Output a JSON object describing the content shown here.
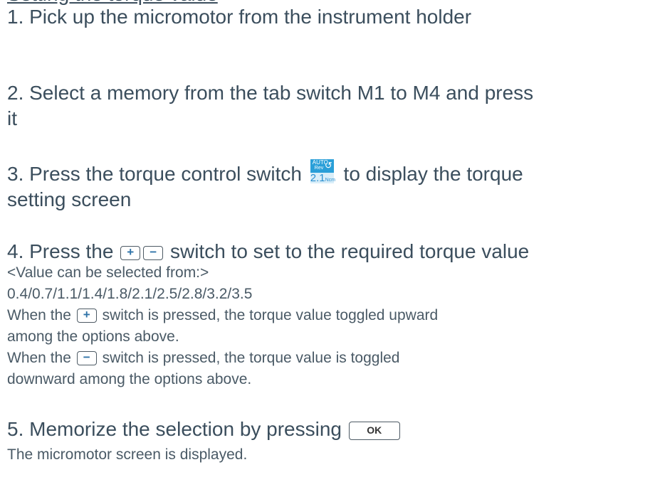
{
  "heading_fragment": "Setting the torque value",
  "steps": [
    {
      "text": "1. Pick up the micromotor from the instrument holder"
    },
    {
      "line1": "2. Select a memory from the tab switch M1 to M4 and press",
      "line2": "it"
    },
    {
      "before": "3. Press the torque control switch",
      "after": "to display the torque",
      "line2": "setting screen"
    },
    {
      "before": "4. Press the",
      "after": "switch to set to the required torque value"
    },
    {
      "before": "5. Memorize the selection by pressing"
    }
  ],
  "notes": {
    "range_label": "<Value can be selected from:>",
    "range_values": "0.4/0.7/1.1/1.4/1.8/2.1/2.5/2.8/3.2/3.5",
    "plus_before": "When the",
    "plus_after": "switch is pressed, the torque value toggled upward",
    "plus_line2": "among the options above.",
    "minus_before": "When the",
    "minus_after": "switch is pressed, the torque value is toggled",
    "minus_line2": "downward among the options above.",
    "result": "The micromotor screen is displayed."
  },
  "torque_icon": {
    "auto": "AUTO",
    "rev": "Rev",
    "value": "2.1",
    "unit": "Ncm",
    "arrow": "↺",
    "icon_name": "torque-control-icon"
  },
  "keys": {
    "plus": "+",
    "minus": "−",
    "ok": "OK"
  },
  "colors": {
    "text": "#3b4e5d",
    "icon_blue": "#2a9fd8",
    "key_symbol": "#2f73a8"
  }
}
